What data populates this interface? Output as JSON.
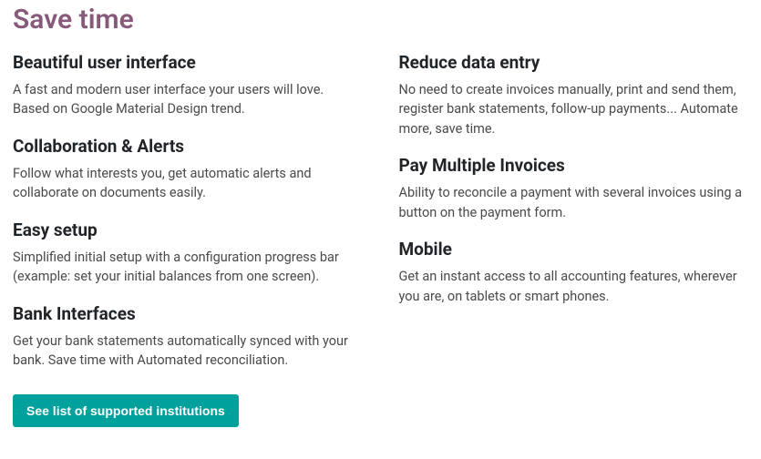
{
  "section_title": "Save time",
  "left": [
    {
      "title": "Beautiful user interface",
      "desc": "A fast and modern user interface your users will love. Based on Google Material Design trend."
    },
    {
      "title": "Collaboration & Alerts",
      "desc": "Follow what interests you, get automatic alerts and collaborate on documents easily."
    },
    {
      "title": "Easy setup",
      "desc": "Simplified initial setup with a configuration progress bar (example: set your initial balances from one screen)."
    },
    {
      "title": "Bank Interfaces",
      "desc": "Get your bank statements automatically synced with your bank. Save time with Automated reconciliation."
    }
  ],
  "right": [
    {
      "title": "Reduce data entry",
      "desc": "No need to create invoices manually, print and send them, register bank statements, follow-up payments... Automate more, save time."
    },
    {
      "title": "Pay Multiple Invoices",
      "desc": "Ability to reconcile a payment with several invoices using a button on the payment form."
    },
    {
      "title": "Mobile",
      "desc": "Get an instant access to all accounting features, wherever you are, on tablets or smart phones."
    }
  ],
  "button_label": "See list of supported institutions"
}
